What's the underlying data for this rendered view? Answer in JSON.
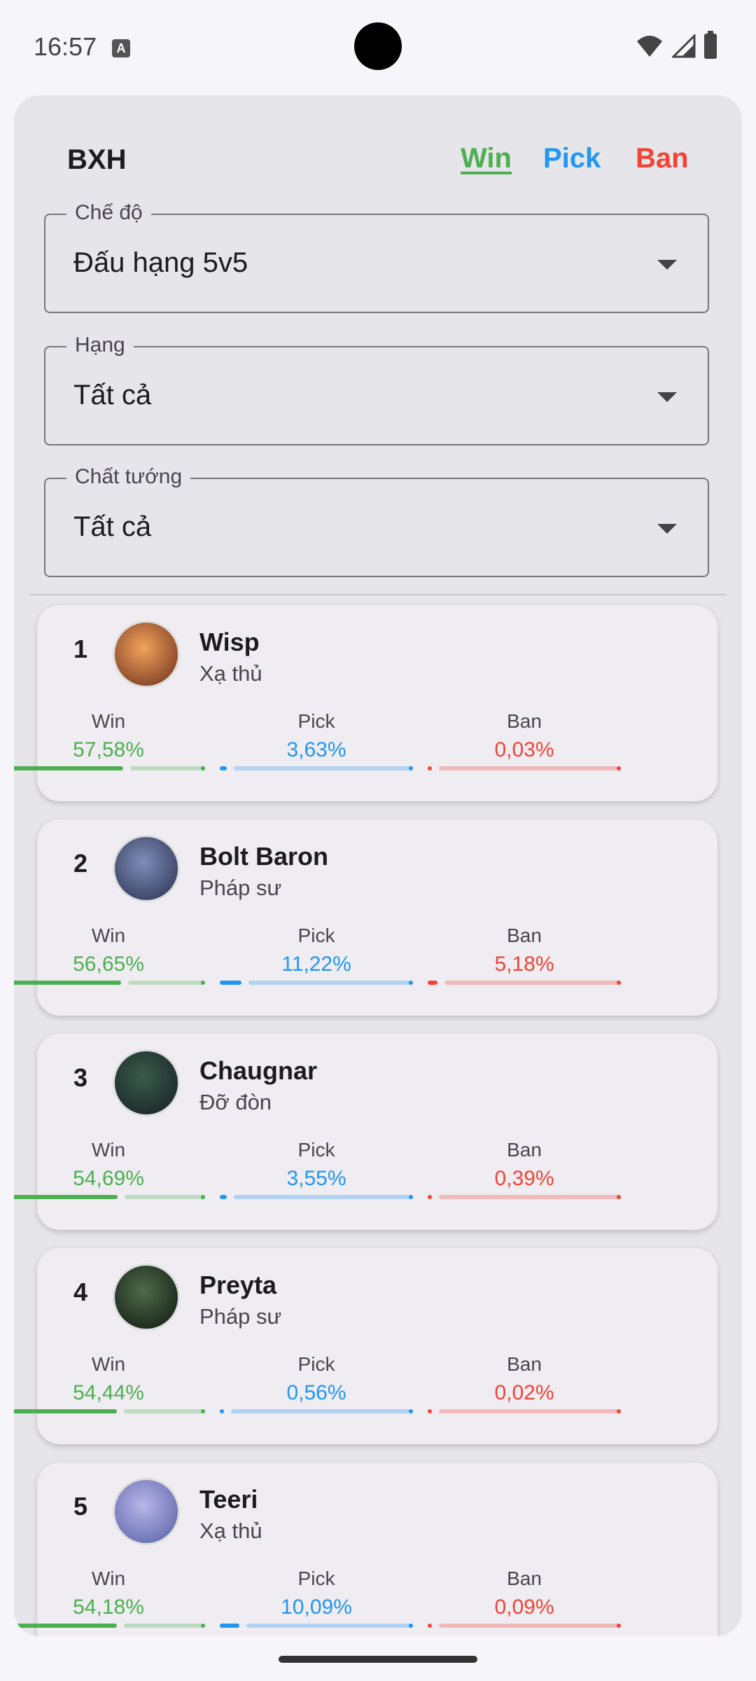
{
  "status": {
    "time": "16:57",
    "notif_icon": "A"
  },
  "header": {
    "title": "BXH",
    "tabs": [
      {
        "label": "Win",
        "color": "#4caf50"
      },
      {
        "label": "Pick",
        "color": "#2196f3"
      },
      {
        "label": "Ban",
        "color": "#f44336"
      }
    ]
  },
  "filters": [
    {
      "label": "Chế độ",
      "value": "Đấu hạng 5v5"
    },
    {
      "label": "Hạng",
      "value": "Tất cả"
    },
    {
      "label": "Chất tướng",
      "value": "Tất cả"
    }
  ],
  "stat_labels": {
    "win": "Win",
    "pick": "Pick",
    "ban": "Ban"
  },
  "colors": {
    "win": "#4caf50",
    "pick": "#2196f3",
    "ban": "#f44336"
  },
  "heroes": [
    {
      "rank": "1",
      "name": "Wisp",
      "role": "Xạ thủ",
      "avatar_icon": "hero-avatar-wisp",
      "win": "57,58%",
      "pick": "3,63%",
      "ban": "0,03%",
      "win_frac": 0.5758,
      "pick_frac": 0.0363,
      "ban_frac": 0.0003
    },
    {
      "rank": "2",
      "name": "Bolt Baron",
      "role": "Pháp sư",
      "avatar_icon": "hero-avatar-bolt-baron",
      "win": "56,65%",
      "pick": "11,22%",
      "ban": "5,18%",
      "win_frac": 0.5665,
      "pick_frac": 0.1122,
      "ban_frac": 0.0518
    },
    {
      "rank": "3",
      "name": "Chaugnar",
      "role": "Đỡ đòn",
      "avatar_icon": "hero-avatar-chaugnar",
      "win": "54,69%",
      "pick": "3,55%",
      "ban": "0,39%",
      "win_frac": 0.5469,
      "pick_frac": 0.0355,
      "ban_frac": 0.0039
    },
    {
      "rank": "4",
      "name": "Preyta",
      "role": "Pháp sư",
      "avatar_icon": "hero-avatar-preyta",
      "win": "54,44%",
      "pick": "0,56%",
      "ban": "0,02%",
      "win_frac": 0.5444,
      "pick_frac": 0.0056,
      "ban_frac": 0.0002
    },
    {
      "rank": "5",
      "name": "Teeri",
      "role": "Xạ thủ",
      "avatar_icon": "hero-avatar-teeri",
      "win": "54,18%",
      "pick": "10,09%",
      "ban": "0,09%",
      "win_frac": 0.5418,
      "pick_frac": 0.1009,
      "ban_frac": 0.0009
    }
  ]
}
